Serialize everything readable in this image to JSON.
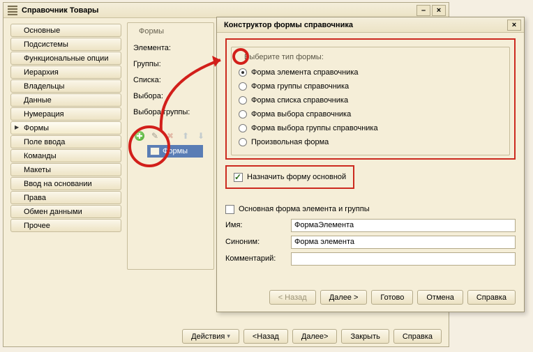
{
  "main_window": {
    "title": "Справочник Товары",
    "minimize": "–",
    "close": "×"
  },
  "sidebar": {
    "items": [
      {
        "label": "Основные"
      },
      {
        "label": "Подсистемы"
      },
      {
        "label": "Функциональные опции"
      },
      {
        "label": "Иерархия"
      },
      {
        "label": "Владельцы"
      },
      {
        "label": "Данные"
      },
      {
        "label": "Нумерация"
      },
      {
        "label": "Формы",
        "active": true
      },
      {
        "label": "Поле ввода"
      },
      {
        "label": "Команды"
      },
      {
        "label": "Макеты"
      },
      {
        "label": "Ввод на основании"
      },
      {
        "label": "Права"
      },
      {
        "label": "Обмен данными"
      },
      {
        "label": "Прочее"
      }
    ]
  },
  "forms_panel": {
    "group_title": "Формы",
    "rows": [
      "Элемента:",
      "Группы:",
      "Списка:",
      "Выбора:",
      "Выбора группы:"
    ],
    "tree_root": "Формы"
  },
  "dialog": {
    "title": "Конструктор формы справочника",
    "close": "×",
    "type_group": "Выберите тип формы:",
    "types": [
      "Форма элемента справочника",
      "Форма группы справочника",
      "Форма списка справочника",
      "Форма выбора справочника",
      "Форма выбора группы справочника",
      "Произвольная форма"
    ],
    "selected_type_index": 0,
    "make_default_label": "Назначить форму основной",
    "make_default_checked": true,
    "element_group_form_label": "Основная форма элемента и группы",
    "element_group_form_checked": false,
    "name_label": "Имя:",
    "name_value": "ФормаЭлемента",
    "synonym_label": "Синоним:",
    "synonym_value": "Форма элемента",
    "comment_label": "Комментарий:",
    "comment_value": "",
    "buttons": {
      "back": "< Назад",
      "next": "Далее >",
      "finish": "Готово",
      "cancel": "Отмена",
      "help": "Справка"
    }
  },
  "bottom": {
    "actions": "Действия",
    "back": "<Назад",
    "next": "Далее>",
    "close": "Закрыть",
    "help": "Справка"
  }
}
